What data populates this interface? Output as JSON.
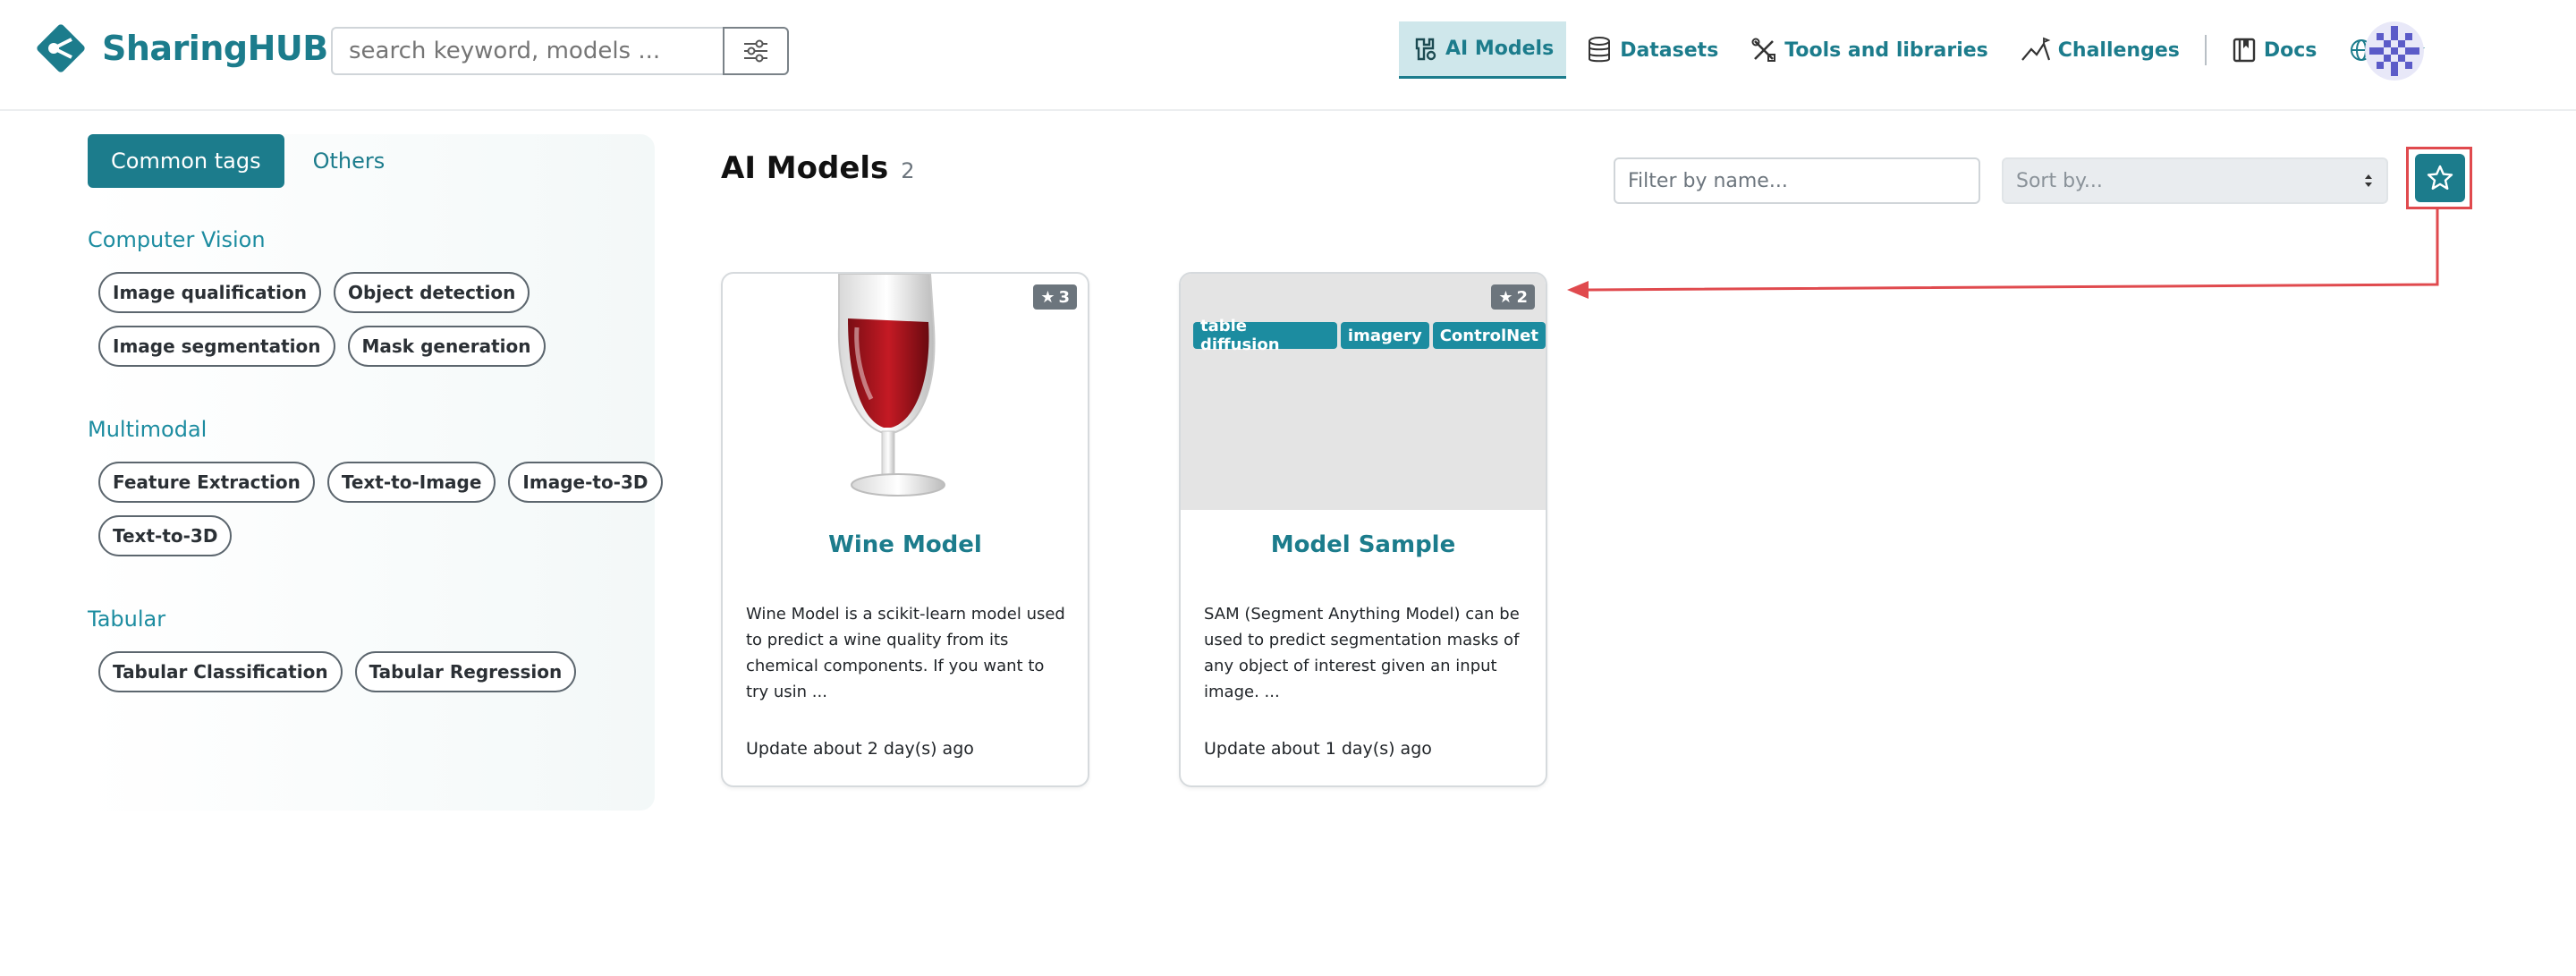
{
  "header": {
    "logo_text": "SharingHUB",
    "search_placeholder": "search keyword, models ...",
    "nav": {
      "ai_models": "AI Models",
      "datasets": "Datasets",
      "tools": "Tools and libraries",
      "challenges": "Challenges",
      "docs": "Docs",
      "language": "en"
    }
  },
  "sidebar": {
    "tabs": [
      "Common tags",
      "Others"
    ],
    "sections": [
      {
        "title": "Computer Vision",
        "tags": [
          "Image qualification",
          "Object detection",
          "Image segmentation",
          "Mask generation"
        ]
      },
      {
        "title": "Multimodal",
        "tags": [
          "Feature Extraction",
          "Text-to-Image",
          "Image-to-3D",
          "Text-to-3D"
        ]
      },
      {
        "title": "Tabular",
        "tags": [
          "Tabular Classification",
          "Tabular Regression"
        ]
      }
    ]
  },
  "main": {
    "title": "AI Models",
    "count": "2",
    "filter_placeholder": "Filter by name...",
    "sort_placeholder": "Sort by...",
    "cards": [
      {
        "title": "Wine Model",
        "stars": "3",
        "tags": [],
        "description": "Wine Model is a scikit-learn model used to predict a wine quality from its chemical components. If you want to try usin ...",
        "updated": "Update about 2 day(s) ago"
      },
      {
        "title": "Model Sample",
        "stars": "2",
        "tags": [
          "table diffusion",
          "imagery",
          "ControlNet"
        ],
        "description": "SAM (Segment Anything Model) can be used to predict segmentation masks of any object of interest given an input image. ...",
        "updated": "Update about 1 day(s) ago"
      }
    ]
  },
  "colors": {
    "brand": "#1c7c8c",
    "highlight": "#e04a4e"
  }
}
